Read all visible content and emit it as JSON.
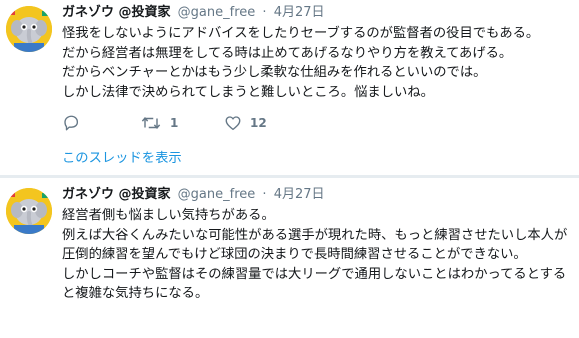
{
  "tweets": [
    {
      "author": "ガネゾウ @投資家",
      "handle": "@gane_free",
      "separator": "·",
      "date": "4月27日",
      "lines": [
        "怪我をしないようにアドバイスをしたりセーブするのが監督者の役目でもある。",
        "だから経営者は無理をしてる時は止めてあげるなりやり方を教えてあげる。",
        "だからベンチャーとかはもう少し柔軟な仕組みを作れるといいのでは。",
        "しかし法律で決められてしまうと難しいところ。悩ましいね。"
      ],
      "actions": {
        "reply_icon": "reply-icon",
        "retweet_icon": "retweet-icon",
        "retweet_count": "1",
        "like_icon": "heart-icon",
        "like_count": "12"
      },
      "thread_link": "このスレッドを表示"
    },
    {
      "author": "ガネゾウ @投資家",
      "handle": "@gane_free",
      "separator": "·",
      "date": "4月27日",
      "lines": [
        "経営者側も悩ましい気持ちがある。",
        "例えば大谷くんみたいな可能性がある選手が現れた時、もっと練習させたいし本人が圧倒的練習を望んでもけど球団の決まりで長時間練習させることができない。",
        "しかしコーチや監督はその練習量では大リーグで通用しないことはわかってるとすると複雑な気持ちになる。"
      ]
    }
  ],
  "colors": {
    "accent": "#1b95e0",
    "secondary": "#657786",
    "avatar_bg": "#f3c51f",
    "divider": "#e6ecf0"
  }
}
